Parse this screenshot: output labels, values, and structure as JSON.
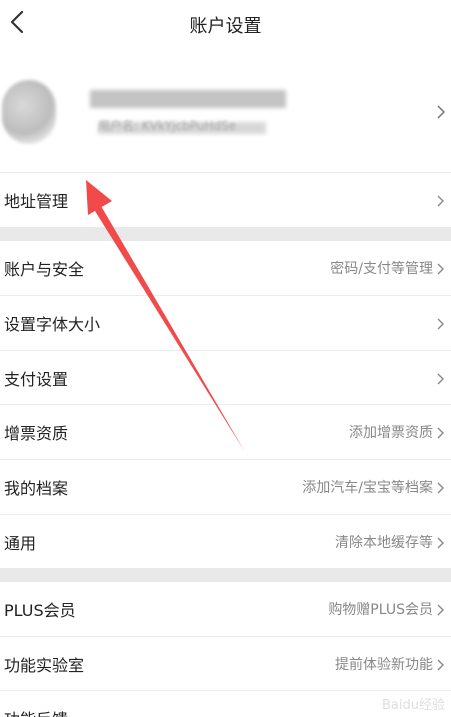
{
  "header": {
    "title": "账户设置"
  },
  "profile": {
    "sub_text": "用户名: KVkYjcbPuHdSe"
  },
  "rows": [
    {
      "label": "地址管理",
      "hint": ""
    },
    {
      "label": "账户与安全",
      "hint": "密码/支付等管理"
    },
    {
      "label": "设置字体大小",
      "hint": ""
    },
    {
      "label": "支付设置",
      "hint": ""
    },
    {
      "label": "增票资质",
      "hint": "添加增票资质"
    },
    {
      "label": "我的档案",
      "hint": "添加汽车/宝宝等档案"
    },
    {
      "label": "通用",
      "hint": "清除本地缓存等"
    },
    {
      "label": "PLUS会员",
      "hint": "购物赠PLUS会员"
    },
    {
      "label": "功能实验室",
      "hint": "提前体验新功能"
    },
    {
      "label": "功能反馈",
      "hint": ""
    }
  ],
  "watermark": "Baidu经验",
  "colors": {
    "annotation_arrow": "#f04a4a",
    "section_gap": "#e9e9e9"
  }
}
